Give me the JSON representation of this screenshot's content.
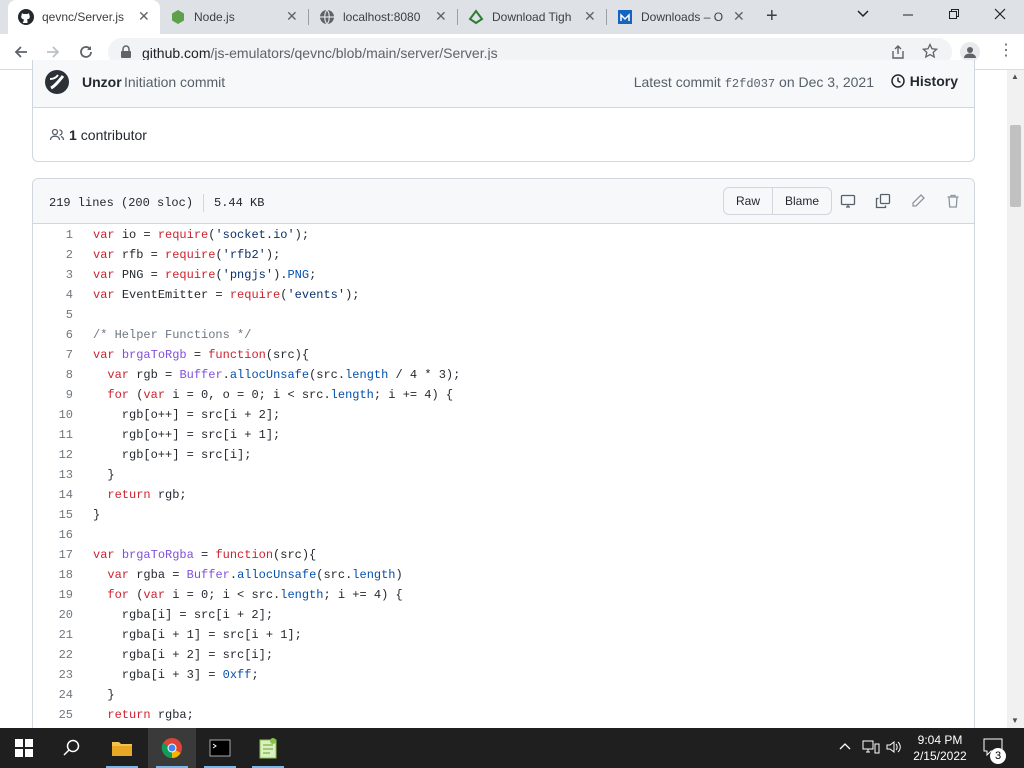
{
  "browser": {
    "tabs": [
      {
        "title": "qevnc/Server.js",
        "icon": "github-icon",
        "active": true
      },
      {
        "title": "Node.js",
        "icon": "nodejs-icon",
        "active": false
      },
      {
        "title": "localhost:8080",
        "icon": "globe-icon",
        "active": false
      },
      {
        "title": "Download Tigh",
        "icon": "tightvnc-icon",
        "active": false
      },
      {
        "title": "Downloads – O",
        "icon": "downloads-icon",
        "active": false
      }
    ],
    "url_host": "github.com",
    "url_path": "/js-emulators/qevnc/blob/main/server/Server.js"
  },
  "commit": {
    "author": "Unzor",
    "message": "Initiation commit",
    "latest_prefix": "Latest commit",
    "sha": "f2fd037",
    "date": "on Dec 3, 2021",
    "history_label": "History",
    "contributors_count": "1",
    "contributors_label": "contributor"
  },
  "file": {
    "lines_info": "219 lines (200 sloc)",
    "size": "5.44 KB",
    "raw_label": "Raw",
    "blame_label": "Blame"
  },
  "code_lines": [
    [
      [
        "k",
        "var"
      ],
      [
        "",
        "io = "
      ],
      [
        "k",
        "require"
      ],
      [
        "",
        "("
      ],
      [
        "s",
        "'socket.io'"
      ],
      [
        "",
        ");"
      ]
    ],
    [
      [
        "k",
        "var"
      ],
      [
        "",
        "rfb = "
      ],
      [
        "k",
        "require"
      ],
      [
        "",
        "("
      ],
      [
        "s",
        "'rfb2'"
      ],
      [
        "",
        ");"
      ]
    ],
    [
      [
        "k",
        "var"
      ],
      [
        "",
        "PNG = "
      ],
      [
        "k",
        "require"
      ],
      [
        "",
        "("
      ],
      [
        "s",
        "'pngjs'"
      ],
      [
        "",
        ")."
      ],
      [
        "n",
        "PNG"
      ],
      [
        "",
        ";"
      ]
    ],
    [
      [
        "k",
        "var"
      ],
      [
        "",
        "EventEmitter = "
      ],
      [
        "k",
        "require"
      ],
      [
        "",
        "("
      ],
      [
        "s",
        "'events'"
      ],
      [
        "",
        ");"
      ]
    ],
    [],
    [
      [
        "c",
        "/* Helper Functions */"
      ]
    ],
    [
      [
        "k",
        "var"
      ],
      [
        "",
        ""
      ],
      [
        "f",
        "brgaToRgb"
      ],
      [
        "",
        " = "
      ],
      [
        "k",
        "function"
      ],
      [
        "",
        "(src){"
      ]
    ],
    [
      [
        "",
        "  "
      ],
      [
        "k",
        "var"
      ],
      [
        "",
        "rgb = "
      ],
      [
        "f",
        "Buffer"
      ],
      [
        "",
        "."
      ],
      [
        "n",
        "allocUnsafe"
      ],
      [
        "",
        "(src."
      ],
      [
        "n",
        "length"
      ],
      [
        "",
        " / 4 * 3);"
      ]
    ],
    [
      [
        "",
        "  "
      ],
      [
        "k",
        "for"
      ],
      [
        "",
        " ("
      ],
      [
        "k",
        "var"
      ],
      [
        "",
        " i = 0, o = 0; i < src."
      ],
      [
        "n",
        "length"
      ],
      [
        "",
        "; i += 4) {"
      ]
    ],
    [
      [
        "",
        "    rgb[o++] = src[i + 2];"
      ]
    ],
    [
      [
        "",
        "    rgb[o++] = src[i + 1];"
      ]
    ],
    [
      [
        "",
        "    rgb[o++] = src[i];"
      ]
    ],
    [
      [
        "",
        "  }"
      ]
    ],
    [
      [
        "",
        "  "
      ],
      [
        "k",
        "return"
      ],
      [
        "",
        " rgb;"
      ]
    ],
    [
      [
        "",
        "}"
      ]
    ],
    [],
    [
      [
        "k",
        "var"
      ],
      [
        "",
        ""
      ],
      [
        "f",
        "brgaToRgba"
      ],
      [
        "",
        " = "
      ],
      [
        "k",
        "function"
      ],
      [
        "",
        "(src){"
      ]
    ],
    [
      [
        "",
        "  "
      ],
      [
        "k",
        "var"
      ],
      [
        "",
        "rgba = "
      ],
      [
        "f",
        "Buffer"
      ],
      [
        "",
        "."
      ],
      [
        "n",
        "allocUnsafe"
      ],
      [
        "",
        "(src."
      ],
      [
        "n",
        "length"
      ],
      [
        "",
        ")"
      ]
    ],
    [
      [
        "",
        "  "
      ],
      [
        "k",
        "for"
      ],
      [
        "",
        " ("
      ],
      [
        "k",
        "var"
      ],
      [
        "",
        " i = 0; i < src."
      ],
      [
        "n",
        "length"
      ],
      [
        "",
        "; i += 4) {"
      ]
    ],
    [
      [
        "",
        "    rgba[i] = src[i + 2];"
      ]
    ],
    [
      [
        "",
        "    rgba[i + 1] = src[i + 1];"
      ]
    ],
    [
      [
        "",
        "    rgba[i + 2] = src[i];"
      ]
    ],
    [
      [
        "",
        "    rgba[i + 3] = "
      ],
      [
        "n",
        "0xff"
      ],
      [
        "",
        ";"
      ]
    ],
    [
      [
        "",
        "  }"
      ]
    ],
    [
      [
        "",
        "  "
      ],
      [
        "k",
        "return"
      ],
      [
        "",
        " rgba;"
      ]
    ]
  ],
  "taskbar": {
    "time": "9:04 PM",
    "date": "2/15/2022",
    "notifications": "3"
  }
}
